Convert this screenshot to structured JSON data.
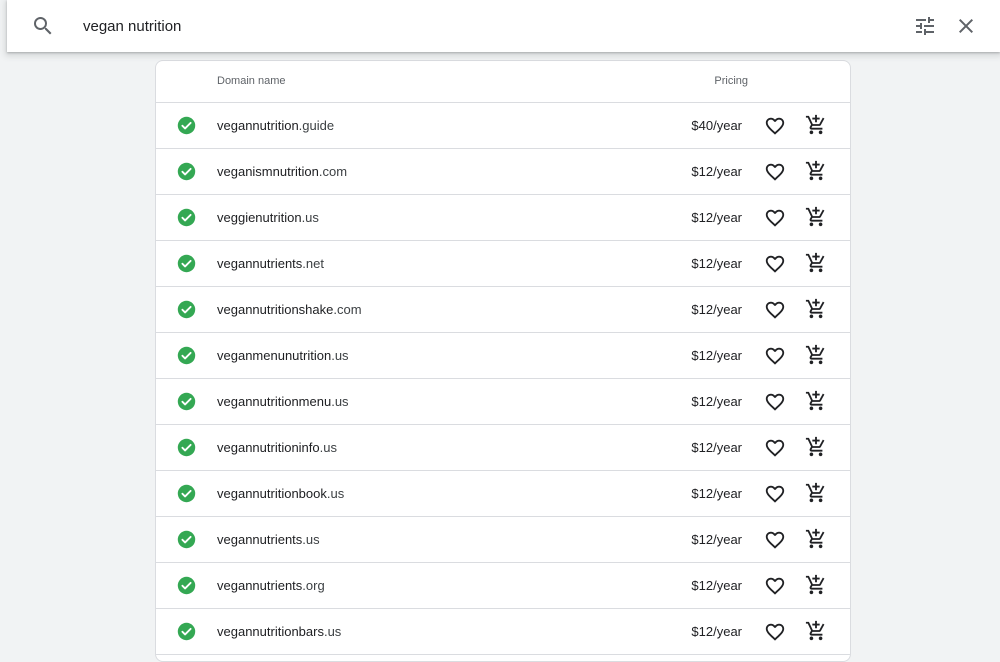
{
  "search": {
    "query": "vegan nutrition"
  },
  "icons": {
    "search": "search-icon",
    "filter": "tune-icon",
    "close": "close-icon",
    "available": "check-circle-icon",
    "favorite": "heart-outline-icon",
    "cart": "add-shopping-cart-icon"
  },
  "colors": {
    "available": "#34a853",
    "text": "#202124",
    "secondary": "#5f6368",
    "divider": "#dadce0",
    "background": "#f1f3f4"
  },
  "table": {
    "headers": {
      "domain": "Domain name",
      "pricing": "Pricing"
    },
    "rows": [
      {
        "name": "vegannutrition",
        "tld": ".guide",
        "price": "$40/year"
      },
      {
        "name": "veganismnutrition",
        "tld": ".com",
        "price": "$12/year"
      },
      {
        "name": "veggienutrition",
        "tld": ".us",
        "price": "$12/year"
      },
      {
        "name": "vegannutrients",
        "tld": ".net",
        "price": "$12/year"
      },
      {
        "name": "vegannutritionshake",
        "tld": ".com",
        "price": "$12/year"
      },
      {
        "name": "veganmenunutrition",
        "tld": ".us",
        "price": "$12/year"
      },
      {
        "name": "vegannutritionmenu",
        "tld": ".us",
        "price": "$12/year"
      },
      {
        "name": "vegannutritioninfo",
        "tld": ".us",
        "price": "$12/year"
      },
      {
        "name": "vegannutritionbook",
        "tld": ".us",
        "price": "$12/year"
      },
      {
        "name": "vegannutrients",
        "tld": ".us",
        "price": "$12/year"
      },
      {
        "name": "vegannutrients",
        "tld": ".org",
        "price": "$12/year"
      },
      {
        "name": "vegannutritionbars",
        "tld": ".us",
        "price": "$12/year"
      }
    ]
  }
}
